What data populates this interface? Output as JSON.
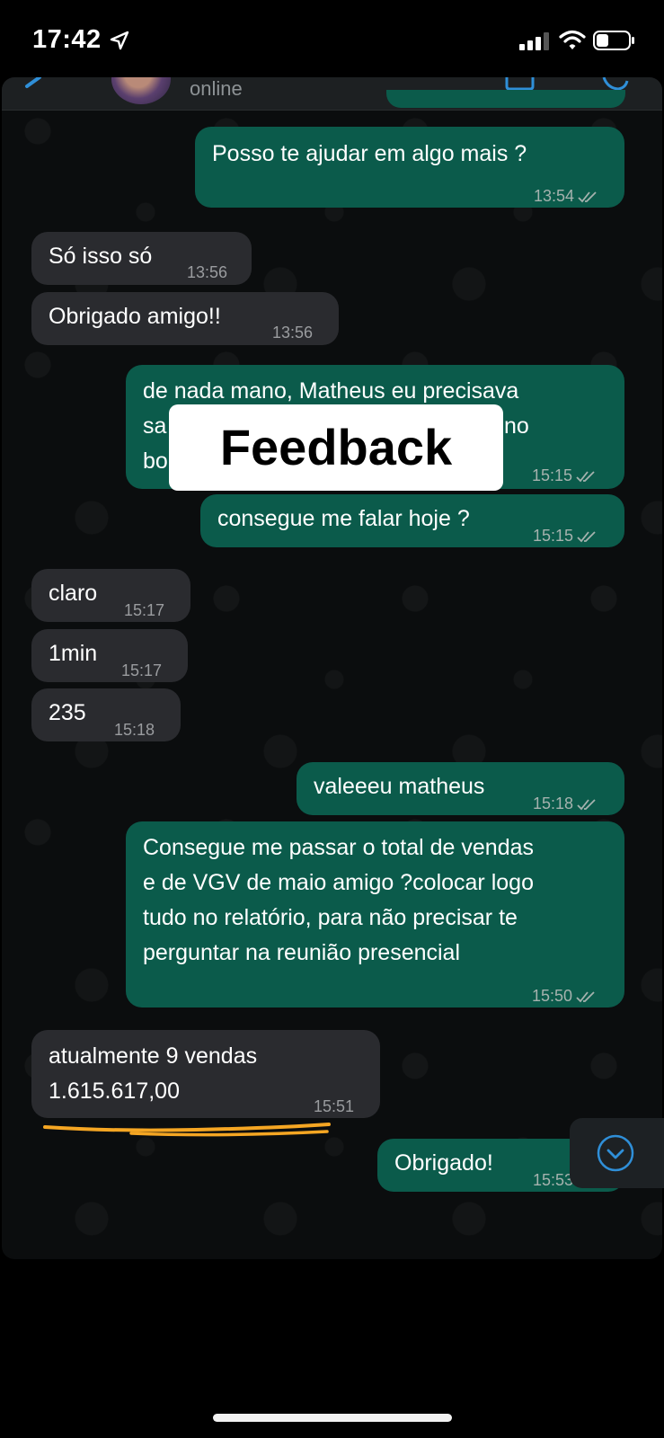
{
  "status_bar": {
    "time": "17:42"
  },
  "header": {
    "contact_status": "online"
  },
  "overlay": {
    "label": "Feedback"
  },
  "messages": [
    {
      "dir": "out",
      "text": "Posso te ajudar em algo mais ?",
      "time": "13:54"
    },
    {
      "dir": "in",
      "text": "Só isso só",
      "time": "13:56"
    },
    {
      "dir": "in",
      "text": "Obrigado amigo!!",
      "time": "13:56"
    },
    {
      "dir": "out",
      "line1": "de nada mano, Matheus eu precisava",
      "line2_left": "sa",
      "line2_right": "no",
      "line3_left": "bo",
      "time": "15:15"
    },
    {
      "dir": "out",
      "text": "consegue me falar hoje ?",
      "time": "15:15"
    },
    {
      "dir": "in",
      "text": "claro",
      "time": "15:17"
    },
    {
      "dir": "in",
      "text": "1min",
      "time": "15:17"
    },
    {
      "dir": "in",
      "text": "235",
      "time": "15:18"
    },
    {
      "dir": "out",
      "text": "valeeeu matheus",
      "time": "15:18"
    },
    {
      "dir": "out",
      "lines": [
        "Consegue me passar o total de vendas",
        "e de VGV de maio amigo ?colocar logo",
        "tudo no relatório, para não precisar te",
        "perguntar na reunião presencial"
      ],
      "time": "15:50"
    },
    {
      "dir": "in",
      "lines": [
        "atualmente 9 vendas",
        "1.615.617,00"
      ],
      "time": "15:51"
    },
    {
      "dir": "out",
      "text": "Obrigado!",
      "time": "15:53"
    }
  ],
  "colors": {
    "outgoing": "#0b5b4b",
    "incoming": "#2a2b2f",
    "highlight": "#f5a623",
    "accent": "#2f8fd8"
  },
  "icons": [
    "location-arrow-icon",
    "signal-icon",
    "wifi-icon",
    "battery-icon",
    "back-chevron-icon",
    "video-call-icon",
    "phone-call-icon",
    "read-ticks-icon",
    "scroll-down-icon"
  ]
}
